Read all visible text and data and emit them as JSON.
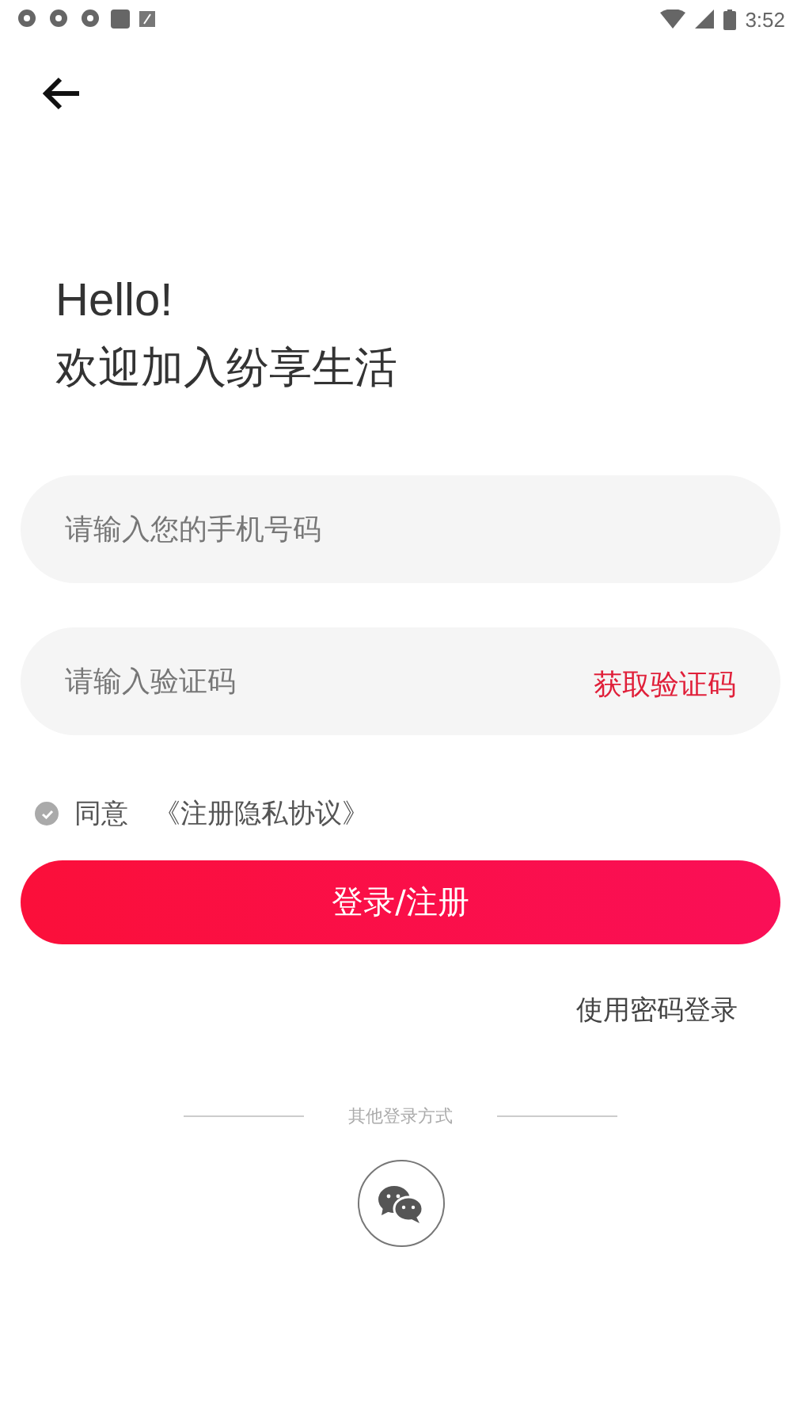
{
  "status_bar": {
    "time": "3:52"
  },
  "greeting": {
    "line_1": "Hello!",
    "line_2": "欢迎加入纷享生活"
  },
  "phone_field": {
    "placeholder": "请输入您的手机号码"
  },
  "code_field": {
    "placeholder": "请输入验证码",
    "action": "获取验证码"
  },
  "agreement": {
    "checked": true,
    "label": "同意",
    "link": "《注册隐私协议》"
  },
  "login_button": "登录/注册",
  "password_login_link": "使用密码登录",
  "other_methods": {
    "label": "其他登录方式"
  }
}
